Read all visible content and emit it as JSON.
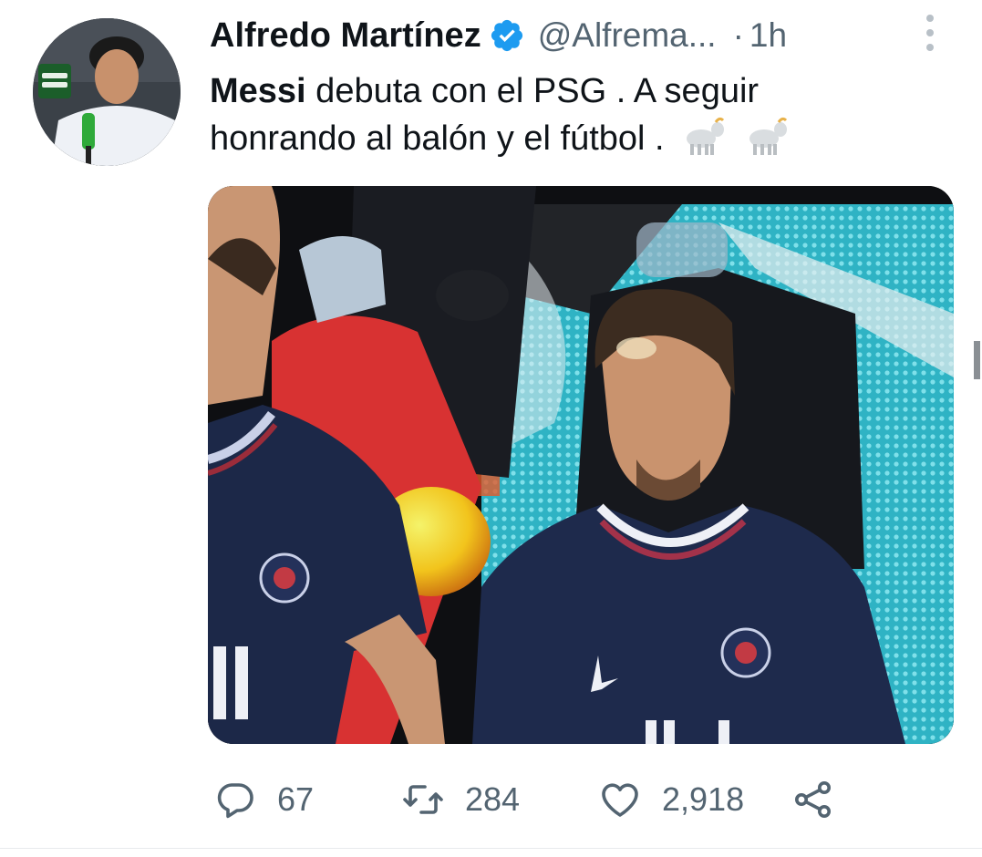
{
  "tweet": {
    "author": {
      "display_name": "Alfredo Martínez",
      "handle": "@Alfrema...",
      "verified": true,
      "avatar_icon": "profile-photo"
    },
    "separator": "·",
    "time": "1h",
    "text": {
      "bold": "Messi",
      "line1_rest": " debuta con el PSG . A seguir",
      "line2": "honrando al balón y el fútbol ."
    },
    "emojis": [
      "goat-icon",
      "goat-icon"
    ],
    "media": {
      "description_icon": "photo"
    },
    "stats": {
      "replies": "67",
      "retweets": "284",
      "likes": "2,918"
    }
  },
  "colors": {
    "text": "#0f1419",
    "muted": "#536471",
    "verified": "#1d9bf0"
  }
}
